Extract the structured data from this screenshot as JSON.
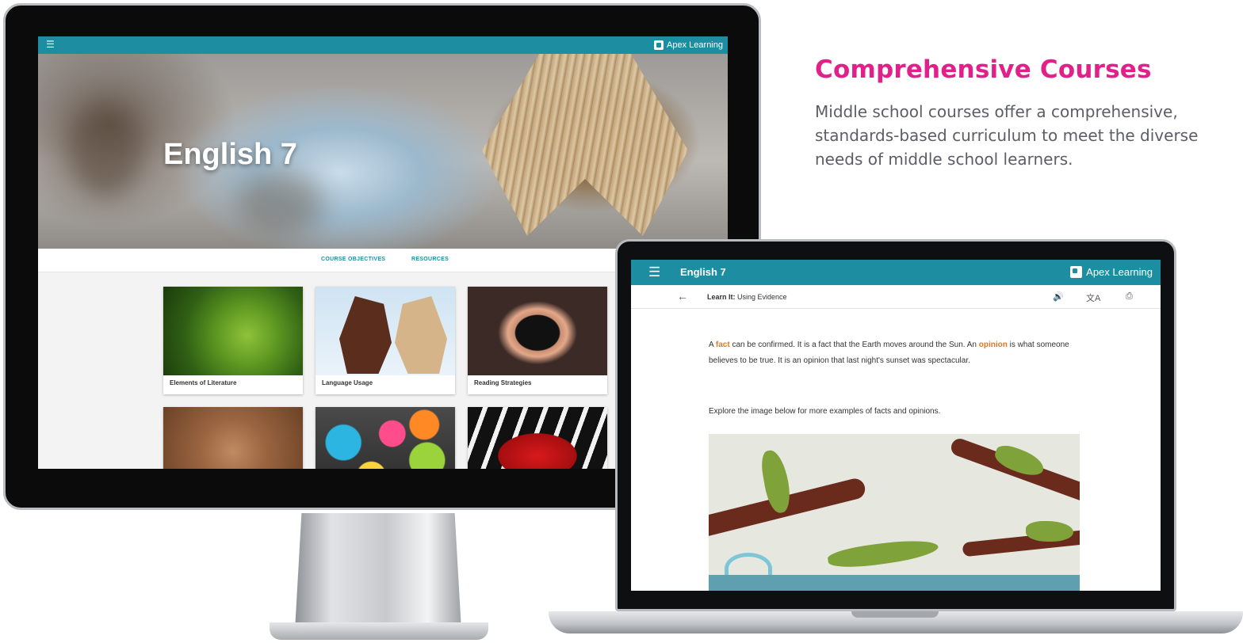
{
  "promo": {
    "title": "Comprehensive Courses",
    "body": "Middle school courses offer a comprehensive, standards-based curriculum to meet the diverse needs of middle school learners."
  },
  "brand": {
    "name": "Apex Learning",
    "accent_color": "#1d8ea1",
    "headline_color": "#e0218a",
    "highlight_color": "#e8761e"
  },
  "desktop": {
    "menu_icon": "list-icon",
    "course_title": "English 7",
    "tabs": [
      {
        "label": "COURSE OBJECTIVES"
      },
      {
        "label": "RESOURCES"
      }
    ],
    "cards": [
      {
        "label": "Elements of Literature",
        "image": "lizard-photo"
      },
      {
        "label": "Language Usage",
        "image": "horse-chess-photo"
      },
      {
        "label": "Reading Strategies",
        "image": "heart-hands-photo"
      },
      {
        "label": "",
        "image": "cave-hands-photo"
      },
      {
        "label": "",
        "image": "paint-cans-photo"
      },
      {
        "label": "",
        "image": "bow-tie-piano-photo"
      }
    ]
  },
  "laptop": {
    "menu_icon": "list-icon",
    "course_title": "English 7",
    "breadcrumb_prefix": "Learn It:",
    "breadcrumb_title": "Using Evidence",
    "tools": [
      "audio-icon",
      "translate-icon",
      "print-icon"
    ],
    "paragraph": {
      "p1_a": "A ",
      "term_fact": "fact",
      "p1_b": " can be confirmed. It is a fact that the Earth moves around the Sun. An ",
      "term_opinion": "opinion",
      "p1_c": " is what someone believes to be true. It is an opinion that last night's sunset was spectacular."
    },
    "instruction": "Explore the image below for more examples of facts and opinions."
  }
}
